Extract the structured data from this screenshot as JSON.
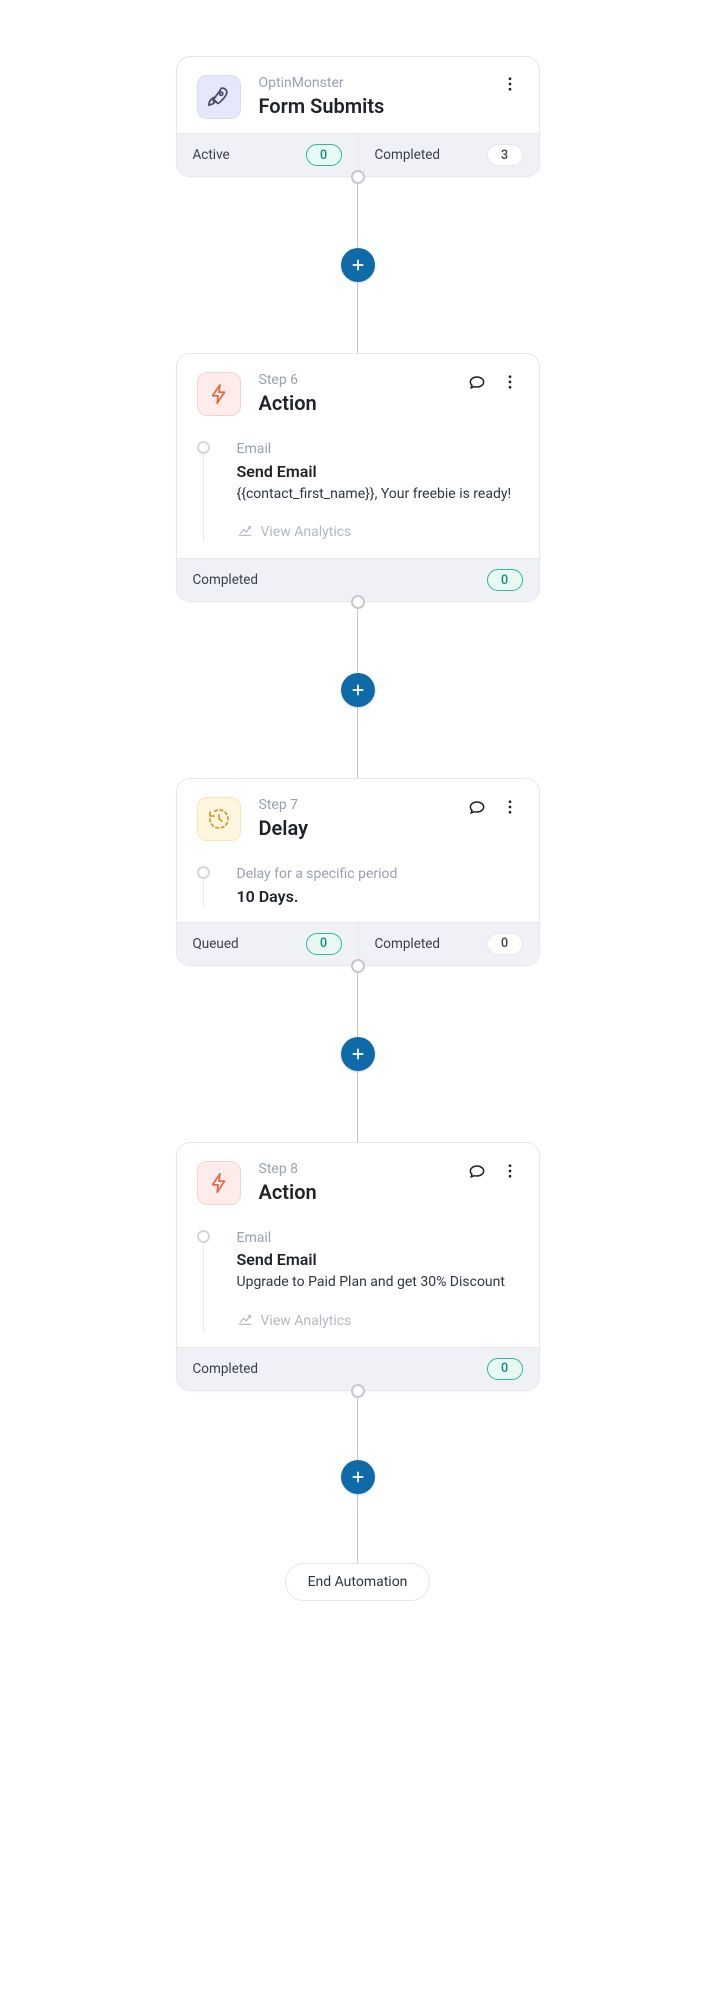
{
  "trigger": {
    "subtitle": "OptinMonster",
    "title": "Form Submits",
    "footer": {
      "active_label": "Active",
      "active_count": "0",
      "completed_label": "Completed",
      "completed_count": "3"
    }
  },
  "steps": [
    {
      "step_label": "Step 6",
      "type_label": "Action",
      "detail_label": "Email",
      "detail_title": "Send Email",
      "detail_desc": "{{contact_first_name}}, Your freebie is ready!",
      "analytics_label": "View Analytics",
      "footer": {
        "completed_label": "Completed",
        "completed_count": "0"
      }
    },
    {
      "step_label": "Step 7",
      "type_label": "Delay",
      "detail_label": "Delay for a specific period",
      "detail_title": "10 Days.",
      "footer": {
        "queued_label": "Queued",
        "queued_count": "0",
        "completed_label": "Completed",
        "completed_count": "0"
      }
    },
    {
      "step_label": "Step 8",
      "type_label": "Action",
      "detail_label": "Email",
      "detail_title": "Send Email",
      "detail_desc": "Upgrade to Paid Plan and get 30% Discount",
      "analytics_label": "View Analytics",
      "footer": {
        "completed_label": "Completed",
        "completed_count": "0"
      }
    }
  ],
  "end_label": "End Automation",
  "icons": {
    "trigger": "rocket-icon",
    "action": "bolt-icon",
    "delay": "clock-icon",
    "chat": "chat-icon",
    "more": "more-vertical-icon",
    "analytics": "growth-chart-icon",
    "add": "plus-icon"
  },
  "colors": {
    "add_button": "#0e6ba8",
    "pill_green_border": "#2fb89a"
  }
}
